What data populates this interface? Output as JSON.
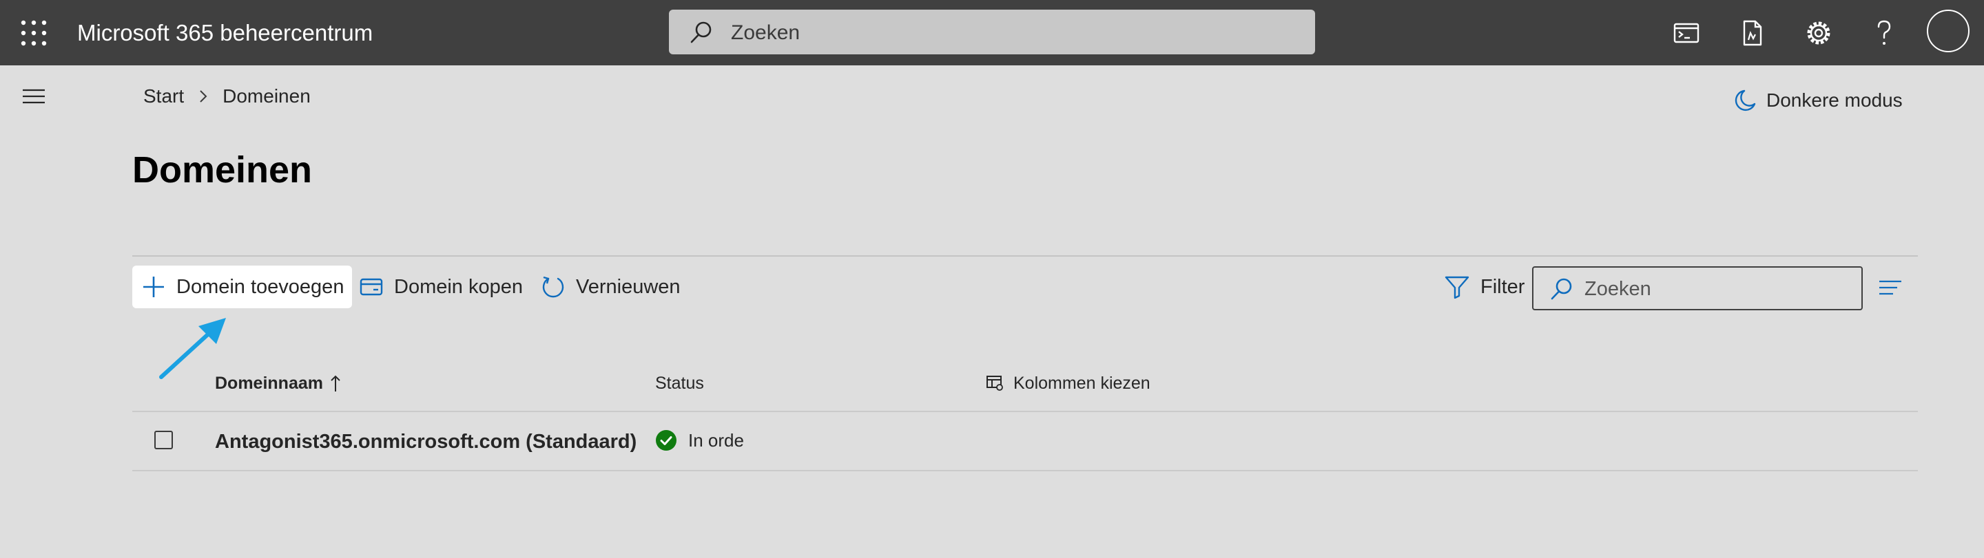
{
  "app": {
    "title": "Microsoft 365 beheercentrum",
    "search_placeholder": "Zoeken"
  },
  "header_icons": [
    "terminal-icon",
    "document-icon",
    "gear-icon",
    "help-icon",
    "avatar"
  ],
  "breadcrumb": {
    "items": [
      "Start",
      "Domeinen"
    ]
  },
  "dark_mode": {
    "label": "Donkere modus"
  },
  "page": {
    "title": "Domeinen"
  },
  "toolbar": {
    "add_domain": "Domein toevoegen",
    "buy_domain": "Domein kopen",
    "refresh": "Vernieuwen",
    "filter": "Filter",
    "search_placeholder": "Zoeken"
  },
  "table": {
    "columns": {
      "domain_name": "Domeinnaam",
      "status": "Status",
      "choose_columns": "Kolommen kiezen"
    },
    "sort": "ascending",
    "rows": [
      {
        "domain": "Antagonist365.onmicrosoft.com (Standaard)",
        "status": "In orde"
      }
    ]
  },
  "colors": {
    "topbar": "#404040",
    "background": "#dedede",
    "accent": "#0f6cbd",
    "status_ok": "#107c10",
    "annotation_arrow": "#1ba1e2"
  }
}
